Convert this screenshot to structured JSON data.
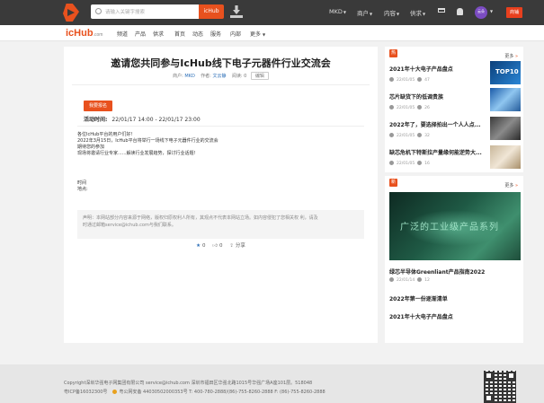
{
  "topbar": {
    "search_placeholder": "请输入关键字搜索",
    "search_button": "icHub",
    "nav": [
      {
        "label": "MKD"
      },
      {
        "label": "商户"
      },
      {
        "label": "内容"
      },
      {
        "label": "供求"
      }
    ],
    "avatar_label": "云朵",
    "red_button": "商铺"
  },
  "subnav": {
    "brand": "icHub",
    "brand_suffix": ".com",
    "items": [
      "频道",
      "产品",
      "供求",
      "首页",
      "动态",
      "服务",
      "内部",
      "更多"
    ]
  },
  "article": {
    "title": "邀请您共同参与IcHub线下电子元器件行业交流会",
    "meta": {
      "merchant_label": "商户:",
      "merchant": "MKD",
      "author_label": "作者:",
      "author": "文云静",
      "reads_label": "阅读:",
      "reads": "0",
      "edit_button": "编辑"
    },
    "signup_button": "我要报名",
    "time_label": "活动时间:",
    "time_value": "22/01/17 14:00 - 22/01/17 23:00",
    "body": [
      "各位IcHub平台的用户们好!",
      "2022年3月15日，IcHub平台将举行一场线下电子元器件行业的交流会",
      "期待您的参加",
      "现场将邀请行业专家......解读行业发展趋势，探讨行业话题!",
      "时间",
      "地点:"
    ],
    "notice_line1": "声明：本网站部分内容来源于网络，版权归原权利人所有，其观点不代表本网站立场。如内容侵犯了您相关权 利，请及",
    "notice_line2": "时通过邮箱service@ichub.com与我们联系。",
    "favorites": "0",
    "likes": "0",
    "share_label": "分享"
  },
  "sidebar_hot": {
    "badge": "热",
    "more": "更多",
    "items": [
      {
        "title": "2021年十大电子产品盘点",
        "date": "22/01/05",
        "views": "47"
      },
      {
        "title": "芯片缺货下的低调贵族",
        "date": "22/01/05",
        "views": "26"
      },
      {
        "title": "2022年了，要选择拍出一个人人点...",
        "date": "22/01/05",
        "views": "32"
      },
      {
        "title": "缺芯危机下特斯拉产量缘何能逆势大...",
        "date": "22/01/05",
        "views": "16"
      }
    ],
    "thumb_text": "TOP10"
  },
  "sidebar_news": {
    "badge": "新",
    "more": "更多",
    "banner_text": "广泛的工业级产品系列",
    "items": [
      {
        "title": "绿芯半导体Greenliant产品指南2022",
        "date": "22/01/14",
        "views": "12"
      },
      {
        "title": "2022年第一份逐渐清单"
      },
      {
        "title": "2021年十大电子产品盘点"
      }
    ]
  },
  "footer": {
    "line1": "Copyright深圳华强电子网集团有限公司   service@ichub.com   深圳市福田区华强北路1015号华强广场A座101层。518048",
    "icp": "粤ICP备16032300号",
    "police": "粤公网安备 44030502000353号 T: 400-780-2888/(86)-755-8260-2888    F: (86)-755-8260-2888"
  },
  "colors": {
    "accent": "#e8511e",
    "topbar": "#3a3a3a",
    "link": "#2d6fb8"
  }
}
